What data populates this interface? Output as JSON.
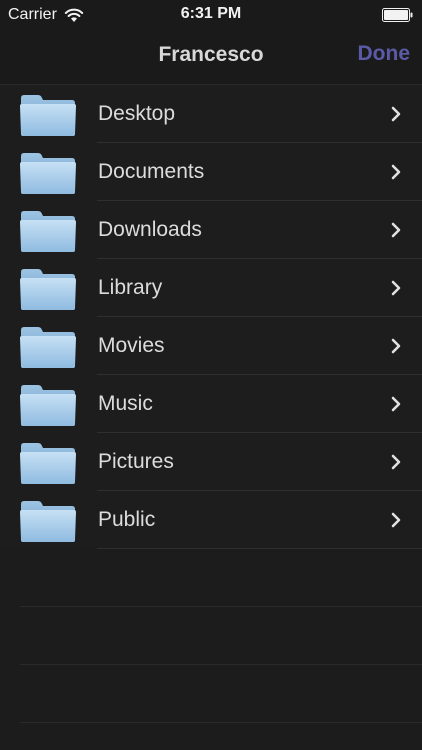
{
  "status_bar": {
    "carrier": "Carrier",
    "time": "6:31 PM",
    "wifi_icon": "wifi-icon",
    "battery_icon": "battery-icon"
  },
  "nav": {
    "title": "Francesco",
    "done_label": "Done",
    "accent_color": "#5b5aa6"
  },
  "folders": [
    {
      "label": "Desktop",
      "icon": "folder-icon"
    },
    {
      "label": "Documents",
      "icon": "folder-icon"
    },
    {
      "label": "Downloads",
      "icon": "folder-icon"
    },
    {
      "label": "Library",
      "icon": "folder-icon"
    },
    {
      "label": "Movies",
      "icon": "folder-icon"
    },
    {
      "label": "Music",
      "icon": "folder-icon"
    },
    {
      "label": "Pictures",
      "icon": "folder-icon"
    },
    {
      "label": "Public",
      "icon": "folder-icon"
    }
  ]
}
